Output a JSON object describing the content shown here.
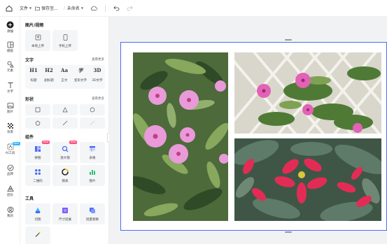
{
  "topbar": {
    "file_label": "文件",
    "save_label": "保存至...",
    "title": "未命名"
  },
  "rail": {
    "items": [
      {
        "label": "添加"
      },
      {
        "label": "模板"
      },
      {
        "label": "元素"
      },
      {
        "label": "文字"
      },
      {
        "label": "图片"
      },
      {
        "label": "背景"
      },
      {
        "label": "AI工具"
      },
      {
        "label": "品牌"
      },
      {
        "label": "团队"
      },
      {
        "label": "我的"
      }
    ],
    "new_badge": "New"
  },
  "panel": {
    "media": {
      "title": "图片/视频",
      "local_upload": "本地上传",
      "phone_upload": "手机上传"
    },
    "text": {
      "title": "文字",
      "more": "查看更多",
      "items": [
        {
          "glyph": "H1",
          "label": "标题"
        },
        {
          "glyph": "H2",
          "label": "副标题"
        },
        {
          "glyph": "Aa",
          "label": "正文"
        },
        {
          "glyph": "字",
          "label": "变形文字"
        },
        {
          "glyph": "3D",
          "label": "3D文字"
        }
      ]
    },
    "shapes": {
      "title": "形状",
      "more": "查看更多"
    },
    "components": {
      "title": "组件",
      "new_badge": "New",
      "items": [
        {
          "label": "拼图"
        },
        {
          "label": "放大镜"
        },
        {
          "label": "表格"
        },
        {
          "label": "二维码"
        },
        {
          "label": "图表"
        },
        {
          "label": "图片"
        }
      ]
    },
    "tools": {
      "title": "工具",
      "items": [
        {
          "label": "切图"
        },
        {
          "label": "尺寸延展"
        },
        {
          "label": "批量替换"
        }
      ]
    }
  },
  "colors": {
    "accent": "#4a6cf7",
    "canvas_bg": "#f1f2f4",
    "new_badge": "#ff4d7a"
  }
}
